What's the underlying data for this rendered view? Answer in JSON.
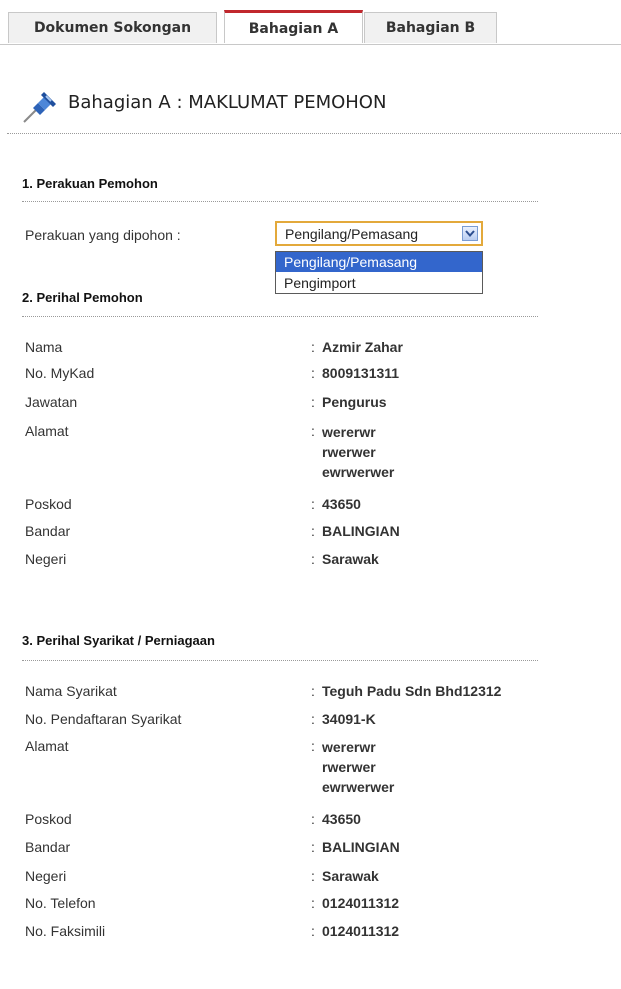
{
  "tabs": [
    {
      "label": "Dokumen Sokongan"
    },
    {
      "label": "Bahagian A"
    },
    {
      "label": "Bahagian B"
    }
  ],
  "page": {
    "title": "Bahagian A : MAKLUMAT PEMOHON"
  },
  "section1": {
    "title": "1. Perakuan Pemohon",
    "field_label": "Perakuan yang dipohon :",
    "selected": "Pengilang/Pemasang",
    "options": [
      "Pengilang/Pemasang",
      "Pengimport"
    ]
  },
  "section2": {
    "title": "2. Perihal Pemohon",
    "rows": [
      {
        "label": "Nama",
        "value": "Azmir Zahar"
      },
      {
        "label": "No. MyKad",
        "value": "8009131311"
      },
      {
        "label": "Jawatan",
        "value": "Pengurus"
      },
      {
        "label": "Alamat",
        "lines": [
          "wererwr",
          "rwerwer",
          "ewrwerwer"
        ]
      },
      {
        "label": "Poskod",
        "value": "43650"
      },
      {
        "label": "Bandar",
        "value": "BALINGIAN"
      },
      {
        "label": "Negeri",
        "value": "Sarawak"
      }
    ]
  },
  "section3": {
    "title": "3. Perihal Syarikat / Perniagaan",
    "rows": [
      {
        "label": "Nama Syarikat",
        "value": "Teguh Padu Sdn Bhd12312"
      },
      {
        "label": "No. Pendaftaran Syarikat",
        "value": "34091-K"
      },
      {
        "label": "Alamat",
        "lines": [
          "wererwr",
          "rwerwer",
          "ewrwerwer"
        ]
      },
      {
        "label": "Poskod",
        "value": "43650"
      },
      {
        "label": "Bandar",
        "value": "BALINGIAN"
      },
      {
        "label": "Negeri",
        "value": "Sarawak"
      },
      {
        "label": "No. Telefon",
        "value": "0124011312"
      },
      {
        "label": "No. Faksimili",
        "value": "0124011312"
      }
    ]
  },
  "colon": ":",
  "colors": {
    "active_tab_accent": "#c1272d",
    "select_border": "#e3a93b",
    "highlight": "#3366cc"
  },
  "icons": {
    "header": "pushpin-icon",
    "select": "chevron-down-icon"
  }
}
